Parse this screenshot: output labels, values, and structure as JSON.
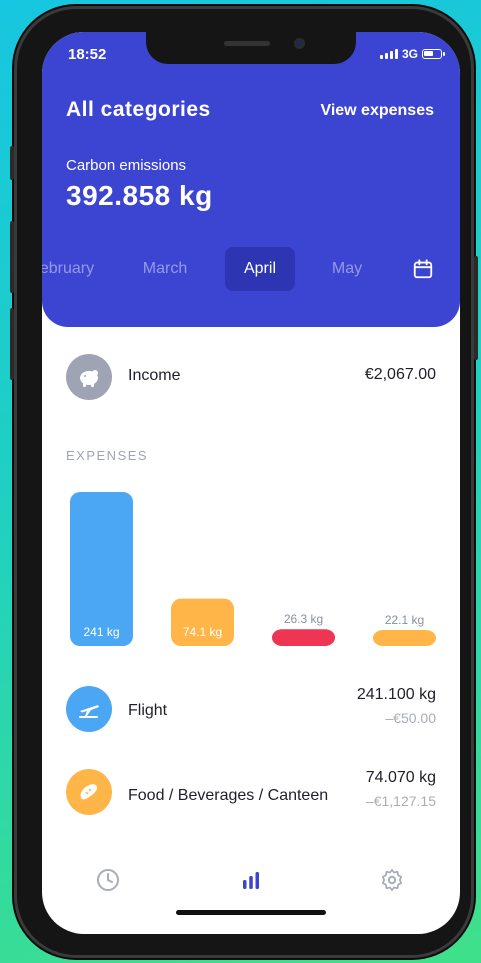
{
  "status_bar": {
    "time": "18:52",
    "network": "3G"
  },
  "header": {
    "title": "All categories",
    "view_expenses": "View expenses",
    "metric_label": "Carbon emissions",
    "metric_value": "392.858 kg"
  },
  "months": [
    {
      "label": "ebruary",
      "active": false
    },
    {
      "label": "March",
      "active": false
    },
    {
      "label": "April",
      "active": true
    },
    {
      "label": "May",
      "active": false
    }
  ],
  "income": {
    "label": "Income",
    "amount": "€2,067.00"
  },
  "expenses_label": "EXPENSES",
  "chart_data": {
    "type": "bar",
    "categories": [
      "Flight",
      "Food / Beverages / Canteen",
      "",
      ""
    ],
    "values": [
      241,
      74.1,
      26.3,
      22.1
    ],
    "data_labels": [
      "241 kg",
      "74.1 kg",
      "26.3 kg",
      "22.1 kg"
    ],
    "colors": [
      "#4ba6f3",
      "#ffb547",
      "#ee3553",
      "#ffb547"
    ],
    "title": "",
    "xlabel": "",
    "ylabel": ""
  },
  "expenses": [
    {
      "name": "Flight",
      "kg": "241.100 kg",
      "eur": "–€50.00",
      "icon": "airplane-icon",
      "color": "#4ba6f3"
    },
    {
      "name": "Food / Beverages / Canteen",
      "kg": "74.070 kg",
      "eur": "–€1,127.15",
      "icon": "bread-icon",
      "color": "#ffb547"
    }
  ],
  "colors": {
    "header": "#3c44d2",
    "accent": "#3c44d2",
    "income_icon": "#9ea4b3"
  }
}
